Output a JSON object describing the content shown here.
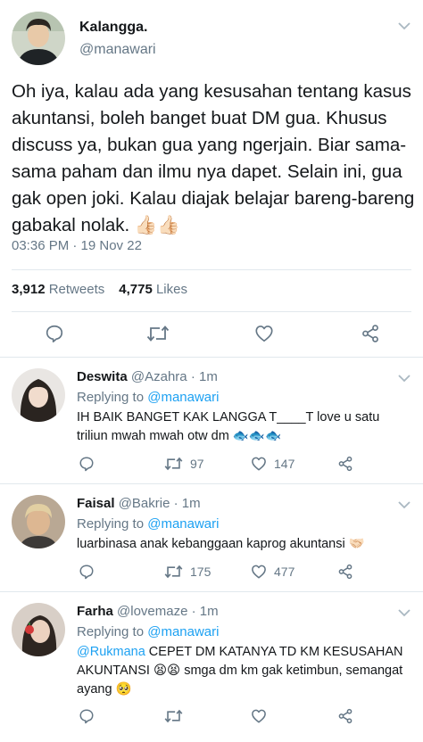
{
  "tweet": {
    "display_name": "Kalangga.",
    "handle": "@manawari",
    "text": "Oh iya, kalau ada yang kesusahan tentang kasus akuntansi, boleh banget buat DM gua. Khusus discuss ya, bukan gua yang ngerjain. Biar sama-sama paham dan ilmu nya dapet. Selain ini, gua gak open joki. Kalau diajak belajar bareng-bareng gabakal nolak. 👍🏻👍🏻",
    "timestamp": "03:36 PM · 19 Nov 22",
    "retweets_count": "3,912",
    "retweets_label": "Retweets",
    "likes_count": "4,775",
    "likes_label": "Likes"
  },
  "replies": [
    {
      "name": "Deswita",
      "handle": "@Azahra",
      "age": "· 1m",
      "replying_label": "Replying to",
      "replying_handle": "@manawari",
      "mention": "",
      "text": "IH BAIK BANGET KAK LANGGA T____T love u satu triliun mwah mwah otw dm 🐟🐟🐟",
      "retweets": "97",
      "likes": "147"
    },
    {
      "name": "Faisal",
      "handle": "@Bakrie",
      "age": "· 1m",
      "replying_label": "Replying to",
      "replying_handle": "@manawari",
      "mention": "",
      "text": "luarbinasa anak kebanggaan kaprog akuntansi 🤝🏻",
      "retweets": "175",
      "likes": "477"
    },
    {
      "name": "Farha",
      "handle": "@lovemaze",
      "age": "· 1m",
      "replying_label": "Replying to",
      "replying_handle": "@manawari",
      "mention": "@Rukmana",
      "text": " CEPET DM KATANYA TD KM KESUSAHAN AKUNTANSI 😫😫 smga dm km gak ketimbun, semangat ayang 🥺",
      "retweets": "",
      "likes": ""
    }
  ],
  "icons": {
    "reply": "reply-icon",
    "retweet": "retweet-icon",
    "like": "heart-icon",
    "share": "share-icon",
    "menu": "chevron-down-icon"
  },
  "colors": {
    "link": "#1da1f2",
    "secondary_text": "#657786",
    "divider": "#e1e8ed"
  }
}
